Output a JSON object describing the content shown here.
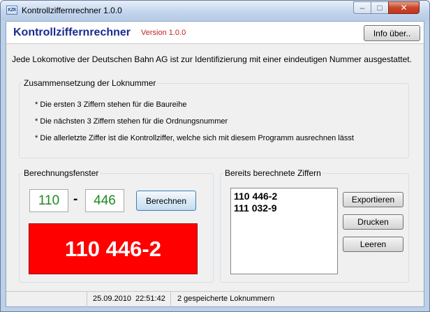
{
  "window": {
    "title": "Kontrollziffernrechner 1.0.0",
    "icon": "calc-app-icon",
    "icon_text": "KZR"
  },
  "controls": {
    "minimize": "–",
    "maximize": "□",
    "close": "✕"
  },
  "header": {
    "app_name": "Kontrollziffernrechner",
    "version": "Version 1.0.0",
    "info_button": "Info über.."
  },
  "intro": "Jede Lokomotive der Deutschen Bahn AG ist zur Identifizierung mit einer eindeutigen Nummer ausgestattet.",
  "composition": {
    "title": "Zusammensetzung der Loknummer",
    "bullets": [
      "* Die ersten 3 Ziffern stehen für die Baureihe",
      "* Die nächsten 3 Ziffern stehen für die Ordnungsnummer",
      "* Die allerletzte Ziffer ist die Kontrollziffer, welche sich mit diesem Programm ausrechnen lässt"
    ]
  },
  "calc": {
    "title": "Berechnungsfenster",
    "part1": "110",
    "separator": "-",
    "part2": "446",
    "button": "Berechnen",
    "result": "110 446-2",
    "result_bg": "#ff0000"
  },
  "computed": {
    "title": "Bereits berechnete Ziffern",
    "items": [
      "110 446-2",
      "111 032-9"
    ],
    "export_button": "Exportieren",
    "print_button": "Drucken",
    "clear_button": "Leeren"
  },
  "status": {
    "date": "25.09.2010",
    "time": "22:51:42",
    "count": "2 gespeicherte Loknummern"
  },
  "colors": {
    "accent": "#1a2b8f",
    "version": "#c02020",
    "input_text": "#1e8a1e"
  }
}
